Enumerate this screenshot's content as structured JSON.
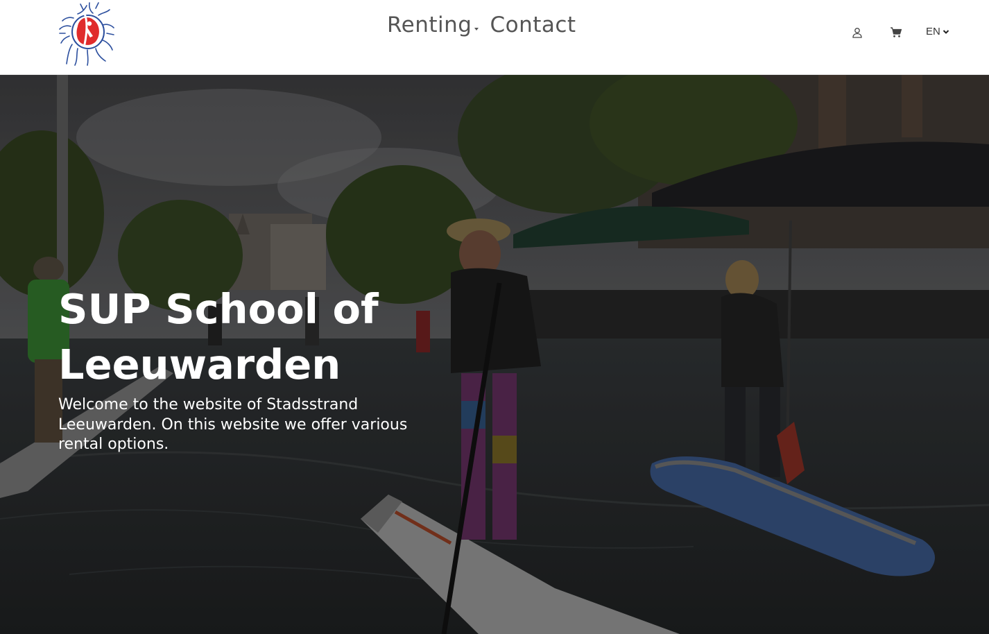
{
  "nav": {
    "renting": "Renting",
    "contact": "Contact"
  },
  "header": {
    "language": "EN",
    "icons": [
      "user-icon",
      "cart-icon",
      "chevron-down-icon"
    ]
  },
  "hero": {
    "title": "SUP School of Leeuwarden",
    "subtitle": "Welcome to the website of Stadsstrand Leeuwarden. On this website we offer various rental options."
  },
  "colors": {
    "logo_red": "#e02b2b",
    "logo_blue": "#2c4f9e",
    "nav_text": "#555555",
    "hero_text": "#ffffff"
  }
}
